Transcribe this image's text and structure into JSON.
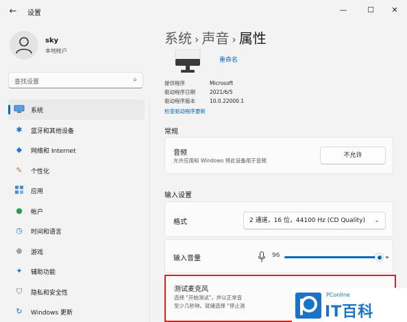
{
  "window": {
    "title": "设置",
    "back_icon": "back-arrow-icon",
    "minimize": "—",
    "maximize": "☐",
    "close": "✕"
  },
  "user": {
    "name": "sky",
    "account_type": "本地帐户"
  },
  "search": {
    "placeholder": "查找设置"
  },
  "nav": [
    {
      "label": "系统",
      "icon": "system-display-icon",
      "selected": true
    },
    {
      "label": "蓝牙和其他设备",
      "icon": "bluetooth-icon"
    },
    {
      "label": "网络和 Internet",
      "icon": "wifi-icon"
    },
    {
      "label": "个性化",
      "icon": "brush-icon"
    },
    {
      "label": "应用",
      "icon": "apps-icon"
    },
    {
      "label": "帐户",
      "icon": "account-icon"
    },
    {
      "label": "时间和语言",
      "icon": "clock-globe-icon"
    },
    {
      "label": "游戏",
      "icon": "game-controller-icon"
    },
    {
      "label": "辅助功能",
      "icon": "accessibility-icon"
    },
    {
      "label": "隐私和安全性",
      "icon": "shield-icon"
    },
    {
      "label": "Windows 更新",
      "icon": "update-icon"
    }
  ],
  "breadcrumb": {
    "level1": "系统",
    "level2": "声音",
    "current": "属性",
    "separator": "›"
  },
  "device": {
    "rename_link": "重命名"
  },
  "driver_info": {
    "rows": [
      {
        "key": "提供程序",
        "value": "Microsoft"
      },
      {
        "key": "驱动程序日期",
        "value": "2021/6/5"
      },
      {
        "key": "驱动程序版本",
        "value": "10.0.22000.1"
      }
    ],
    "update_link": "检查驱动程序更新"
  },
  "general": {
    "heading": "常规",
    "audio": {
      "title": "音频",
      "description": "允许应用和 Windows 将此设备用于音频",
      "button": "不允许"
    }
  },
  "input_settings": {
    "heading": "输入设置",
    "format": {
      "label": "格式",
      "value": "2 通道，16 位，44100 Hz (CD Quality)"
    },
    "volume": {
      "label": "输入音量",
      "value": "96",
      "level": 0.96
    }
  },
  "test_mic": {
    "title": "测试麦克风",
    "line1": "选择 \"开始测试\"，并以正常音",
    "line2": "至少几秒钟。就绪选择 \"停止测"
  },
  "watermark": {
    "brand_small": "PConline",
    "brand_main": "IT百科"
  },
  "colors": {
    "accent": "#0067c0",
    "highlight_border": "#e01e1e",
    "watermark": "#1a73c8"
  }
}
